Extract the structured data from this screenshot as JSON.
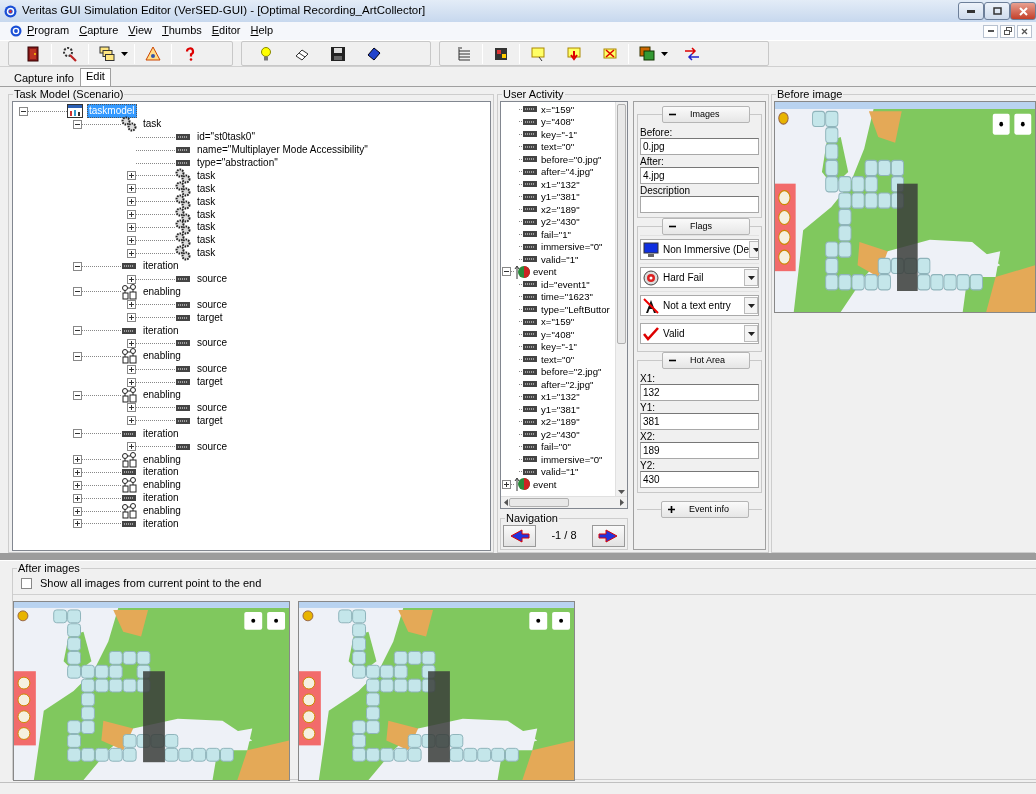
{
  "window": {
    "title": "Veritas GUI Simulation Editor (VerSED-GUI) - [Optimal Recording_ArtCollector]"
  },
  "menu": [
    "Program",
    "Capture",
    "View",
    "Thumbs",
    "Editor",
    "Help"
  ],
  "tabs": [
    {
      "label": "Capture info",
      "selected": false
    },
    {
      "label": "Edit",
      "selected": true
    }
  ],
  "task_model": {
    "title": "Task Model (Scenario)",
    "tree": [
      {
        "label": "taskmodel",
        "kind": "taskmodel",
        "expanded": true,
        "selected": true,
        "children": [
          {
            "label": "task",
            "kind": "task",
            "expanded": true,
            "selected": false,
            "children": [
              {
                "label": "id=\"st0task0\"",
                "kind": "attribute",
                "selected": false
              },
              {
                "label": "name=\"Multiplayer Mode Accessibility\"",
                "kind": "attribute",
                "selected": false
              },
              {
                "label": "type=\"abstraction\"",
                "kind": "attribute",
                "selected": false
              },
              {
                "label": "task",
                "kind": "task",
                "expanded": false,
                "selected": false
              },
              {
                "label": "task",
                "kind": "task",
                "expanded": false,
                "selected": false
              },
              {
                "label": "task",
                "kind": "task",
                "expanded": false,
                "selected": false
              },
              {
                "label": "task",
                "kind": "task",
                "expanded": false,
                "selected": false
              },
              {
                "label": "task",
                "kind": "task",
                "expanded": false,
                "selected": false
              },
              {
                "label": "task",
                "kind": "task",
                "expanded": false,
                "selected": false
              },
              {
                "label": "task",
                "kind": "task",
                "expanded": false,
                "selected": false
              }
            ]
          },
          {
            "label": "iteration",
            "kind": "iteration",
            "expanded": true,
            "selected": false,
            "children": [
              {
                "label": "source",
                "kind": "attribute",
                "expanded": false,
                "selected": false
              }
            ]
          },
          {
            "label": "enabling",
            "kind": "enabling",
            "expanded": true,
            "selected": false,
            "children": [
              {
                "label": "source",
                "kind": "attribute",
                "expanded": false,
                "selected": false
              },
              {
                "label": "target",
                "kind": "attribute",
                "expanded": false,
                "selected": false
              }
            ]
          },
          {
            "label": "iteration",
            "kind": "iteration",
            "expanded": true,
            "selected": false,
            "children": [
              {
                "label": "source",
                "kind": "attribute",
                "expanded": false,
                "selected": false
              }
            ]
          },
          {
            "label": "enabling",
            "kind": "enabling",
            "expanded": true,
            "selected": false,
            "children": [
              {
                "label": "source",
                "kind": "attribute",
                "expanded": false,
                "selected": false
              },
              {
                "label": "target",
                "kind": "attribute",
                "expanded": false,
                "selected": false
              }
            ]
          },
          {
            "label": "enabling",
            "kind": "enabling",
            "expanded": true,
            "selected": false,
            "children": [
              {
                "label": "source",
                "kind": "attribute",
                "expanded": false,
                "selected": false
              },
              {
                "label": "target",
                "kind": "attribute",
                "expanded": false,
                "selected": false
              }
            ]
          },
          {
            "label": "iteration",
            "kind": "iteration",
            "expanded": true,
            "selected": false,
            "children": [
              {
                "label": "source",
                "kind": "attribute",
                "expanded": false,
                "selected": false
              }
            ]
          },
          {
            "label": "enabling",
            "kind": "enabling",
            "expanded": false,
            "selected": false
          },
          {
            "label": "iteration",
            "kind": "iteration",
            "expanded": false,
            "selected": false
          },
          {
            "label": "enabling",
            "kind": "enabling",
            "expanded": false,
            "selected": false
          },
          {
            "label": "iteration",
            "kind": "iteration",
            "expanded": false,
            "selected": false
          },
          {
            "label": "enabling",
            "kind": "enabling",
            "expanded": false,
            "selected": false
          },
          {
            "label": "iteration",
            "kind": "iteration",
            "expanded": false,
            "selected": false
          }
        ]
      }
    ]
  },
  "user_activity": {
    "title": "User Activity",
    "tree": [
      {
        "kind": "continued",
        "children": [
          {
            "label": "x=\"159\"",
            "kind": "attribute"
          },
          {
            "label": "y=\"408\"",
            "kind": "attribute"
          },
          {
            "label": "key=\"-1\"",
            "kind": "attribute"
          },
          {
            "label": "text=\"0\"",
            "kind": "attribute"
          },
          {
            "label": "before=\"0.jpg\"",
            "kind": "attribute"
          },
          {
            "label": "after=\"4.jpg\"",
            "kind": "attribute"
          },
          {
            "label": "x1=\"132\"",
            "kind": "attribute"
          },
          {
            "label": "y1=\"381\"",
            "kind": "attribute"
          },
          {
            "label": "x2=\"189\"",
            "kind": "attribute"
          },
          {
            "label": "y2=\"430\"",
            "kind": "attribute"
          },
          {
            "label": "fail=\"1\"",
            "kind": "attribute"
          },
          {
            "label": "immersive=\"0\"",
            "kind": "attribute"
          },
          {
            "label": "valid=\"1\"",
            "kind": "attribute"
          }
        ]
      },
      {
        "label": "event",
        "kind": "event",
        "expanded": true,
        "children": [
          {
            "label": "id=\"event1\"",
            "kind": "attribute"
          },
          {
            "label": "time=\"1623\"",
            "kind": "attribute"
          },
          {
            "label": "type=\"LeftButtor",
            "kind": "attribute"
          },
          {
            "label": "x=\"159\"",
            "kind": "attribute"
          },
          {
            "label": "y=\"408\"",
            "kind": "attribute"
          },
          {
            "label": "key=\"-1\"",
            "kind": "attribute"
          },
          {
            "label": "text=\"0\"",
            "kind": "attribute"
          },
          {
            "label": "before=\"2.jpg\"",
            "kind": "attribute"
          },
          {
            "label": "after=\"2.jpg\"",
            "kind": "attribute"
          },
          {
            "label": "x1=\"132\"",
            "kind": "attribute"
          },
          {
            "label": "y1=\"381\"",
            "kind": "attribute"
          },
          {
            "label": "x2=\"189\"",
            "kind": "attribute"
          },
          {
            "label": "y2=\"430\"",
            "kind": "attribute"
          },
          {
            "label": "fail=\"0\"",
            "kind": "attribute"
          },
          {
            "label": "immersive=\"0\"",
            "kind": "attribute"
          },
          {
            "label": "valid=\"1\"",
            "kind": "attribute"
          }
        ]
      },
      {
        "label": "event",
        "kind": "event",
        "expanded": false
      }
    ]
  },
  "navigation": {
    "title": "Navigation",
    "position": "-1 / 8"
  },
  "properties": {
    "sections": [
      {
        "title": "Images",
        "expanded": true,
        "kind": "fields",
        "fields": [
          {
            "label": "Before:",
            "value": "0.jpg"
          },
          {
            "label": "After:",
            "value": "4.jpg"
          },
          {
            "label": "Description"
          }
        ]
      },
      {
        "title": "Flags",
        "expanded": true,
        "kind": "dropdowns",
        "dropdowns": [
          {
            "value": "Non Immersive (De",
            "kind": "monitor"
          },
          {
            "value": "Hard Fail",
            "kind": "target"
          },
          {
            "value": "Not a text entry",
            "kind": "no-text"
          },
          {
            "value": "Valid",
            "kind": "check"
          }
        ]
      },
      {
        "title": "Hot Area",
        "expanded": true,
        "kind": "fields",
        "fields": [
          {
            "label": "X1:",
            "value": "132"
          },
          {
            "label": "Y1:",
            "value": "381"
          },
          {
            "label": "X2:",
            "value": "189"
          },
          {
            "label": "Y2:",
            "value": "430"
          }
        ]
      },
      {
        "title": "Event info",
        "expanded": false
      }
    ]
  },
  "before_image": {
    "title": "Before image"
  },
  "after_images": {
    "title": "After images",
    "show_all": {
      "label": "Show all images from current point to the end",
      "checked": false
    },
    "images": [
      {
        "kind": "screenshot"
      },
      {
        "kind": "screenshot"
      }
    ]
  }
}
